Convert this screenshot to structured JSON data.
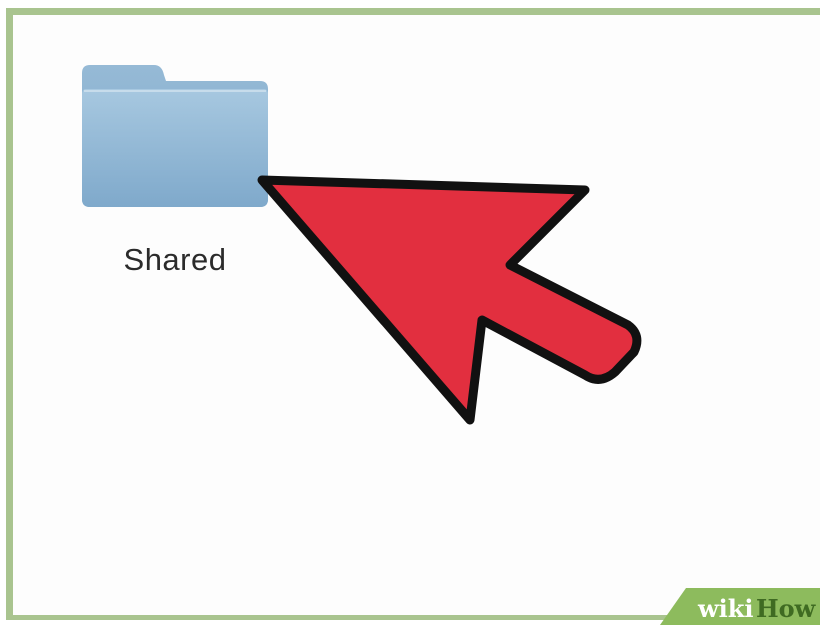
{
  "folder": {
    "label": "Shared",
    "icon": "folder-icon"
  },
  "overlay": {
    "icon": "pointer-arrow-icon",
    "fill_color": "#e22f3f",
    "stroke_color": "#111111"
  },
  "watermark": {
    "part1": "wiki",
    "part2": "How",
    "color": "#8dbb5d"
  },
  "colors": {
    "frame": "#a9c48f",
    "folder": "#8fb6d4"
  }
}
